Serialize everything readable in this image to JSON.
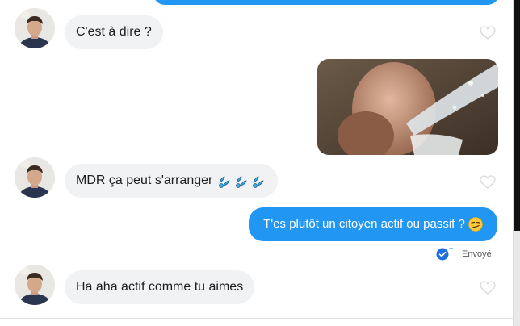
{
  "conversation": {
    "messages": [
      {
        "sender": "contact",
        "type": "text",
        "text": "C'est à dire ?"
      },
      {
        "sender": "me",
        "type": "gif",
        "icon": "gif-image"
      },
      {
        "sender": "contact",
        "type": "text",
        "text": "MDR ça peut s'arranger",
        "emoji": "sweat-droplets-icon"
      },
      {
        "sender": "me",
        "type": "text",
        "text": "T'es plutôt un citoyen actif ou passif ?",
        "emoji": "smirk-face-icon",
        "status": "Envoyé"
      },
      {
        "sender": "contact",
        "type": "text",
        "text": "Ha aha actif comme tu aimes"
      }
    ]
  },
  "colors": {
    "outgoing_bubble": "#2196f3",
    "incoming_bubble": "#f1f2f4",
    "sent_check": "#1e6fe0"
  }
}
